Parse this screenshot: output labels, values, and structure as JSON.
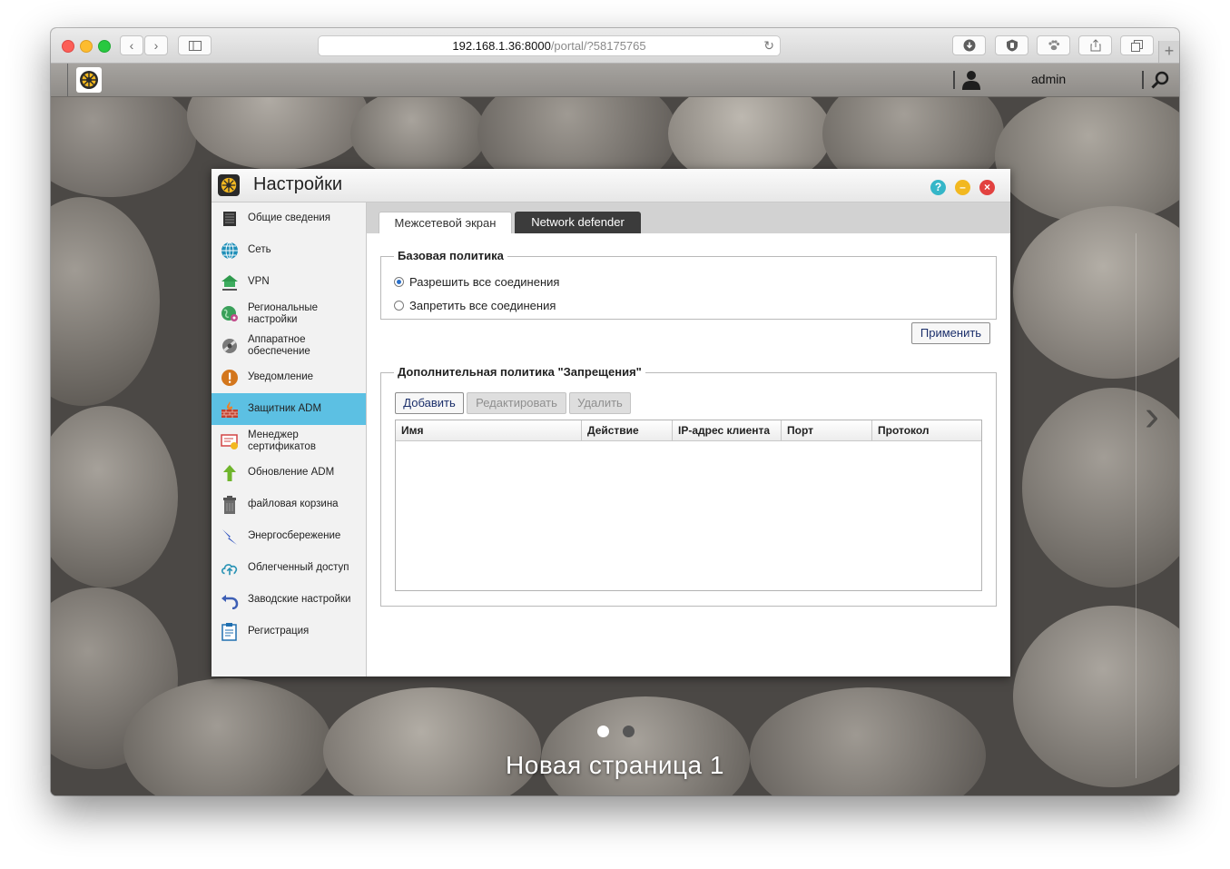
{
  "browser": {
    "url_host": "192.168.1.36:8000",
    "url_path": "/portal/?58175765"
  },
  "adm": {
    "username": "admin"
  },
  "dialog": {
    "title": "Настройки",
    "sidebar": [
      {
        "label": "Общие сведения",
        "icon": "server-icon"
      },
      {
        "label": "Сеть",
        "icon": "globe-icon"
      },
      {
        "label": "VPN",
        "icon": "vpn-house-icon"
      },
      {
        "label": "Региональные настройки",
        "icon": "regional-globe-icon"
      },
      {
        "label": "Аппаратное обеспечение",
        "icon": "hardware-icon"
      },
      {
        "label": "Уведомление",
        "icon": "alert-icon"
      },
      {
        "label": "Защитник ADM",
        "icon": "firewall-icon",
        "active": true
      },
      {
        "label": "Менеджер сертификатов",
        "icon": "certificate-icon"
      },
      {
        "label": "Обновление ADM",
        "icon": "update-arrow-icon"
      },
      {
        "label": "файловая корзина",
        "icon": "trash-icon"
      },
      {
        "label": "Энергосбережение",
        "icon": "energy-icon"
      },
      {
        "label": "Облегченный доступ",
        "icon": "cloud-upload-icon"
      },
      {
        "label": "Заводские настройки",
        "icon": "reset-arrow-icon"
      },
      {
        "label": "Регистрация",
        "icon": "registration-icon"
      }
    ],
    "tabs": {
      "firewall": "Межсетевой экран",
      "network_defender": "Network defender"
    },
    "base_policy": {
      "legend": "Базовая политика",
      "allow_all": "Разрешить все соединения",
      "deny_all": "Запретить все соединения",
      "selected": "allow_all"
    },
    "apply_label": "Применить",
    "extra_policy": {
      "legend": "Дополнительная политика \"Запрещения\"",
      "add": "Добавить",
      "edit": "Редактировать",
      "delete": "Удалить",
      "columns": [
        "Имя",
        "Действие",
        "IP-адрес клиента",
        "Порт",
        "Протокол"
      ],
      "rows": []
    }
  },
  "desktop": {
    "page_title": "Новая страница 1",
    "pages": 2,
    "current_page": 1
  }
}
